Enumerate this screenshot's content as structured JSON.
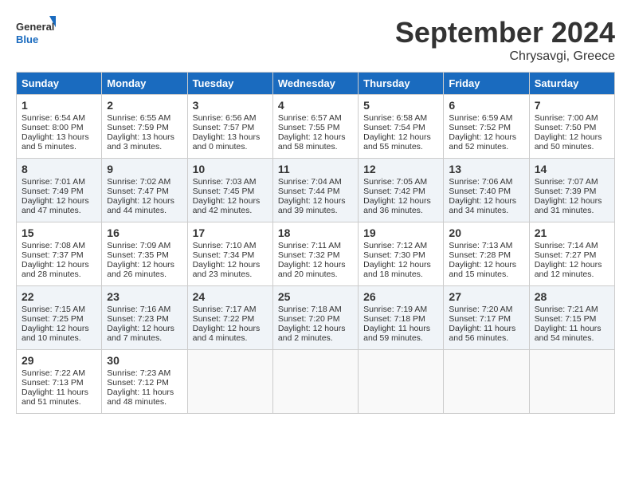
{
  "header": {
    "logo_line1": "General",
    "logo_line2": "Blue",
    "month": "September 2024",
    "location": "Chrysavgi, Greece"
  },
  "days_of_week": [
    "Sunday",
    "Monday",
    "Tuesday",
    "Wednesday",
    "Thursday",
    "Friday",
    "Saturday"
  ],
  "weeks": [
    [
      {
        "day": "1",
        "rise": "Sunrise: 6:54 AM",
        "set": "Sunset: 8:00 PM",
        "daylight": "Daylight: 13 hours and 5 minutes."
      },
      {
        "day": "2",
        "rise": "Sunrise: 6:55 AM",
        "set": "Sunset: 7:59 PM",
        "daylight": "Daylight: 13 hours and 3 minutes."
      },
      {
        "day": "3",
        "rise": "Sunrise: 6:56 AM",
        "set": "Sunset: 7:57 PM",
        "daylight": "Daylight: 13 hours and 0 minutes."
      },
      {
        "day": "4",
        "rise": "Sunrise: 6:57 AM",
        "set": "Sunset: 7:55 PM",
        "daylight": "Daylight: 12 hours and 58 minutes."
      },
      {
        "day": "5",
        "rise": "Sunrise: 6:58 AM",
        "set": "Sunset: 7:54 PM",
        "daylight": "Daylight: 12 hours and 55 minutes."
      },
      {
        "day": "6",
        "rise": "Sunrise: 6:59 AM",
        "set": "Sunset: 7:52 PM",
        "daylight": "Daylight: 12 hours and 52 minutes."
      },
      {
        "day": "7",
        "rise": "Sunrise: 7:00 AM",
        "set": "Sunset: 7:50 PM",
        "daylight": "Daylight: 12 hours and 50 minutes."
      }
    ],
    [
      {
        "day": "8",
        "rise": "Sunrise: 7:01 AM",
        "set": "Sunset: 7:49 PM",
        "daylight": "Daylight: 12 hours and 47 minutes."
      },
      {
        "day": "9",
        "rise": "Sunrise: 7:02 AM",
        "set": "Sunset: 7:47 PM",
        "daylight": "Daylight: 12 hours and 44 minutes."
      },
      {
        "day": "10",
        "rise": "Sunrise: 7:03 AM",
        "set": "Sunset: 7:45 PM",
        "daylight": "Daylight: 12 hours and 42 minutes."
      },
      {
        "day": "11",
        "rise": "Sunrise: 7:04 AM",
        "set": "Sunset: 7:44 PM",
        "daylight": "Daylight: 12 hours and 39 minutes."
      },
      {
        "day": "12",
        "rise": "Sunrise: 7:05 AM",
        "set": "Sunset: 7:42 PM",
        "daylight": "Daylight: 12 hours and 36 minutes."
      },
      {
        "day": "13",
        "rise": "Sunrise: 7:06 AM",
        "set": "Sunset: 7:40 PM",
        "daylight": "Daylight: 12 hours and 34 minutes."
      },
      {
        "day": "14",
        "rise": "Sunrise: 7:07 AM",
        "set": "Sunset: 7:39 PM",
        "daylight": "Daylight: 12 hours and 31 minutes."
      }
    ],
    [
      {
        "day": "15",
        "rise": "Sunrise: 7:08 AM",
        "set": "Sunset: 7:37 PM",
        "daylight": "Daylight: 12 hours and 28 minutes."
      },
      {
        "day": "16",
        "rise": "Sunrise: 7:09 AM",
        "set": "Sunset: 7:35 PM",
        "daylight": "Daylight: 12 hours and 26 minutes."
      },
      {
        "day": "17",
        "rise": "Sunrise: 7:10 AM",
        "set": "Sunset: 7:34 PM",
        "daylight": "Daylight: 12 hours and 23 minutes."
      },
      {
        "day": "18",
        "rise": "Sunrise: 7:11 AM",
        "set": "Sunset: 7:32 PM",
        "daylight": "Daylight: 12 hours and 20 minutes."
      },
      {
        "day": "19",
        "rise": "Sunrise: 7:12 AM",
        "set": "Sunset: 7:30 PM",
        "daylight": "Daylight: 12 hours and 18 minutes."
      },
      {
        "day": "20",
        "rise": "Sunrise: 7:13 AM",
        "set": "Sunset: 7:28 PM",
        "daylight": "Daylight: 12 hours and 15 minutes."
      },
      {
        "day": "21",
        "rise": "Sunrise: 7:14 AM",
        "set": "Sunset: 7:27 PM",
        "daylight": "Daylight: 12 hours and 12 minutes."
      }
    ],
    [
      {
        "day": "22",
        "rise": "Sunrise: 7:15 AM",
        "set": "Sunset: 7:25 PM",
        "daylight": "Daylight: 12 hours and 10 minutes."
      },
      {
        "day": "23",
        "rise": "Sunrise: 7:16 AM",
        "set": "Sunset: 7:23 PM",
        "daylight": "Daylight: 12 hours and 7 minutes."
      },
      {
        "day": "24",
        "rise": "Sunrise: 7:17 AM",
        "set": "Sunset: 7:22 PM",
        "daylight": "Daylight: 12 hours and 4 minutes."
      },
      {
        "day": "25",
        "rise": "Sunrise: 7:18 AM",
        "set": "Sunset: 7:20 PM",
        "daylight": "Daylight: 12 hours and 2 minutes."
      },
      {
        "day": "26",
        "rise": "Sunrise: 7:19 AM",
        "set": "Sunset: 7:18 PM",
        "daylight": "Daylight: 11 hours and 59 minutes."
      },
      {
        "day": "27",
        "rise": "Sunrise: 7:20 AM",
        "set": "Sunset: 7:17 PM",
        "daylight": "Daylight: 11 hours and 56 minutes."
      },
      {
        "day": "28",
        "rise": "Sunrise: 7:21 AM",
        "set": "Sunset: 7:15 PM",
        "daylight": "Daylight: 11 hours and 54 minutes."
      }
    ],
    [
      {
        "day": "29",
        "rise": "Sunrise: 7:22 AM",
        "set": "Sunset: 7:13 PM",
        "daylight": "Daylight: 11 hours and 51 minutes."
      },
      {
        "day": "30",
        "rise": "Sunrise: 7:23 AM",
        "set": "Sunset: 7:12 PM",
        "daylight": "Daylight: 11 hours and 48 minutes."
      },
      null,
      null,
      null,
      null,
      null
    ]
  ]
}
